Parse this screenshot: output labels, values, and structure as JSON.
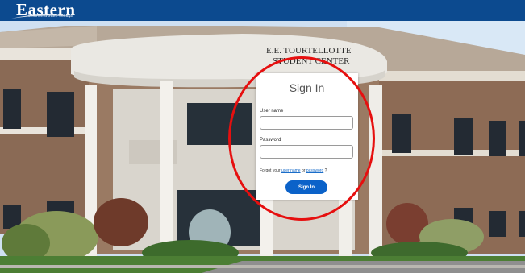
{
  "header": {
    "logo_text": "Eastern",
    "logo_tagline": "oklahoma state college",
    "bar_color": "#0c4a8f"
  },
  "background": {
    "building_sign_line1": "E.E. TOURTELLOTTE",
    "building_sign_line2": "STUDENT CENTER"
  },
  "login": {
    "title": "Sign In",
    "username_label": "User name",
    "username_value": "",
    "password_label": "Password",
    "password_value": "",
    "forgot_prefix": "Forgot your",
    "forgot_user_link": "user name",
    "forgot_or": "or",
    "forgot_password_link": "password",
    "forgot_suffix": "?",
    "submit_label": "Sign In",
    "button_color": "#0b62c9"
  },
  "annotation": {
    "ring_color": "#e60f0f"
  }
}
